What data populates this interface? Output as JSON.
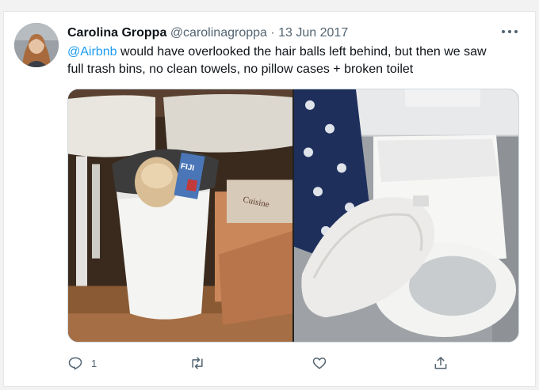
{
  "tweet": {
    "author_name": "Carolina Groppa",
    "handle": "@carolinagroppa",
    "separator": "·",
    "date": "13 Jun 2017",
    "mention": "@Airbnb",
    "text_line1": " would have overlooked the hair balls left behind, but then we saw",
    "text_line2": "full trash bins, no clean towels, no pillow cases + broken toilet"
  },
  "media": {
    "left_photo": {
      "box_print_1": "FIJI",
      "box_print_2": "Cuisine"
    },
    "right_photo": {}
  },
  "actions": {
    "reply_count": "1",
    "icons": [
      "reply-icon",
      "retweet-icon",
      "like-icon",
      "share-icon"
    ]
  },
  "colors": {
    "link": "#1d9bf0",
    "secondary_text": "#536471",
    "primary_text": "#0f1419"
  }
}
